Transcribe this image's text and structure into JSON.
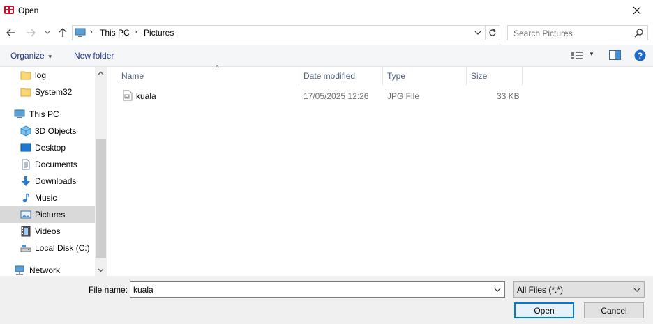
{
  "window": {
    "title": "Open",
    "icon": "app-icon"
  },
  "address": {
    "breadcrumb": [
      "This PC",
      "Pictures"
    ],
    "search_placeholder": "Search Pictures"
  },
  "toolbar": {
    "organize_label": "Organize",
    "new_folder_label": "New folder"
  },
  "nav": {
    "items": [
      {
        "label": "log",
        "icon": "folder-icon"
      },
      {
        "label": "System32",
        "icon": "folder-icon"
      },
      {
        "label": "This PC",
        "icon": "this-pc-icon"
      },
      {
        "label": "3D Objects",
        "icon": "3d-objects-icon"
      },
      {
        "label": "Desktop",
        "icon": "desktop-icon"
      },
      {
        "label": "Documents",
        "icon": "documents-icon"
      },
      {
        "label": "Downloads",
        "icon": "downloads-icon"
      },
      {
        "label": "Music",
        "icon": "music-icon"
      },
      {
        "label": "Pictures",
        "icon": "pictures-icon",
        "selected": true
      },
      {
        "label": "Videos",
        "icon": "videos-icon"
      },
      {
        "label": "Local Disk (C:)",
        "icon": "local-disk-icon"
      },
      {
        "label": "Network",
        "icon": "network-icon"
      }
    ]
  },
  "file_list": {
    "columns": [
      "Name",
      "Date modified",
      "Type",
      "Size"
    ],
    "rows": [
      {
        "name": "kuala",
        "date_modified": "17/05/2025 12:26",
        "type": "JPG File",
        "size": "33 KB"
      }
    ]
  },
  "bottom": {
    "file_name_label": "File name:",
    "file_name_value": "kuala",
    "filter_value": "All Files (*.*)",
    "open_label": "Open",
    "cancel_label": "Cancel"
  },
  "colors": {
    "accent": "#0078d7",
    "selected_bg": "#d9d9d9",
    "link_text": "#1e3287"
  }
}
